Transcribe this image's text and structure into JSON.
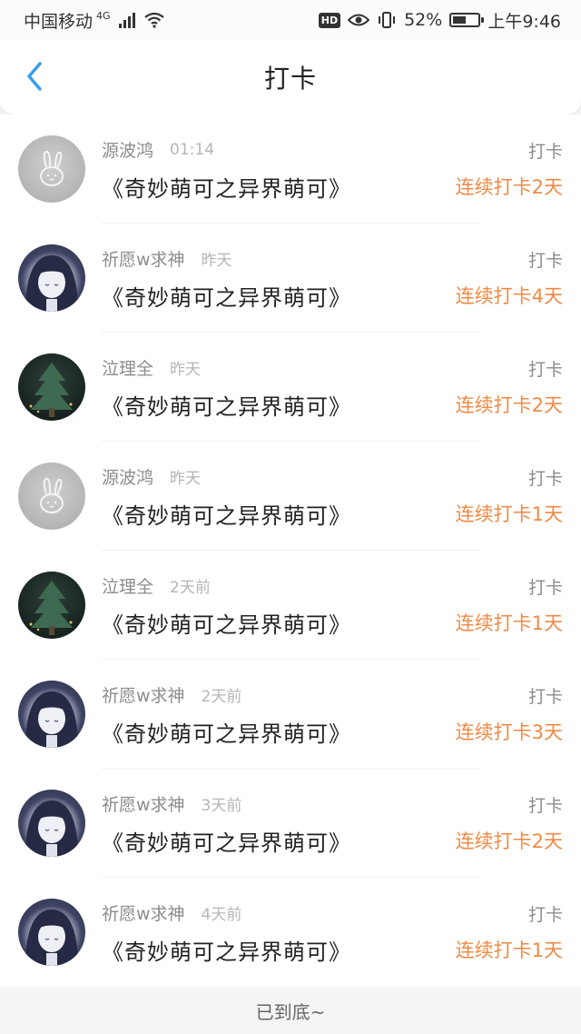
{
  "status_bar": {
    "carrier": "中国移动",
    "network": "4G",
    "hd": "HD",
    "battery_percent": "52%",
    "battery_level": 0.52,
    "time": "上午9:46"
  },
  "header": {
    "title": "打卡",
    "back_icon": "chevron-left-icon",
    "accent": "#3a9ee8"
  },
  "colors": {
    "streak": "#f08a45",
    "muted": "#8c8c8c"
  },
  "entries": [
    {
      "avatar": "rabbit",
      "name": "源波鸿",
      "time": "01:14",
      "book": "《奇妙萌可之异界萌可》",
      "tag": "打卡",
      "streak": "连续打卡2天"
    },
    {
      "avatar": "girl",
      "name": "祈愿w求神",
      "time": "昨天",
      "book": "《奇妙萌可之异界萌可》",
      "tag": "打卡",
      "streak": "连续打卡4天"
    },
    {
      "avatar": "tree",
      "name": "泣理全",
      "time": "昨天",
      "book": "《奇妙萌可之异界萌可》",
      "tag": "打卡",
      "streak": "连续打卡2天"
    },
    {
      "avatar": "rabbit",
      "name": "源波鸿",
      "time": "昨天",
      "book": "《奇妙萌可之异界萌可》",
      "tag": "打卡",
      "streak": "连续打卡1天"
    },
    {
      "avatar": "tree",
      "name": "泣理全",
      "time": "2天前",
      "book": "《奇妙萌可之异界萌可》",
      "tag": "打卡",
      "streak": "连续打卡1天"
    },
    {
      "avatar": "girl",
      "name": "祈愿w求神",
      "time": "2天前",
      "book": "《奇妙萌可之异界萌可》",
      "tag": "打卡",
      "streak": "连续打卡3天"
    },
    {
      "avatar": "girl",
      "name": "祈愿w求神",
      "time": "3天前",
      "book": "《奇妙萌可之异界萌可》",
      "tag": "打卡",
      "streak": "连续打卡2天"
    },
    {
      "avatar": "girl",
      "name": "祈愿w求神",
      "time": "4天前",
      "book": "《奇妙萌可之异界萌可》",
      "tag": "打卡",
      "streak": "连续打卡1天"
    }
  ],
  "footer": {
    "text": "已到底~"
  }
}
